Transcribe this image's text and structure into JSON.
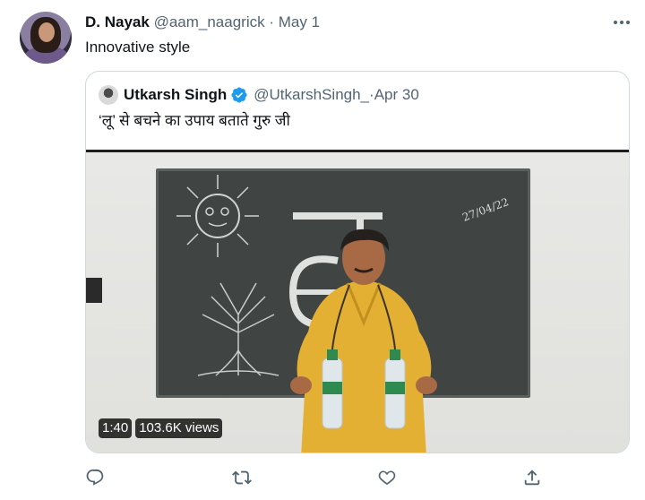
{
  "tweet": {
    "author_name": "D. Nayak",
    "author_handle": "@aam_naagrick",
    "separator": "·",
    "date": "May 1",
    "text": "Innovative style"
  },
  "quoted_tweet": {
    "author_name": "Utkarsh Singh",
    "author_handle": "@UtkarshSingh_",
    "separator": "·",
    "date": "Apr 30",
    "text": "‘लू’ से बचने का उपाय बताते गुरु जी",
    "verified": true
  },
  "video": {
    "duration": "1:40",
    "views": "103.6K views",
    "board_date": "27/04/22"
  },
  "actions": [
    {
      "name": "reply",
      "icon": "reply-icon"
    },
    {
      "name": "retweet",
      "icon": "retweet-icon"
    },
    {
      "name": "like",
      "icon": "heart-icon"
    },
    {
      "name": "share",
      "icon": "share-icon"
    }
  ],
  "colors": {
    "text_primary": "#0f1419",
    "text_secondary": "#536471",
    "verified": "#1d9bf0",
    "border": "#cfd9de"
  }
}
